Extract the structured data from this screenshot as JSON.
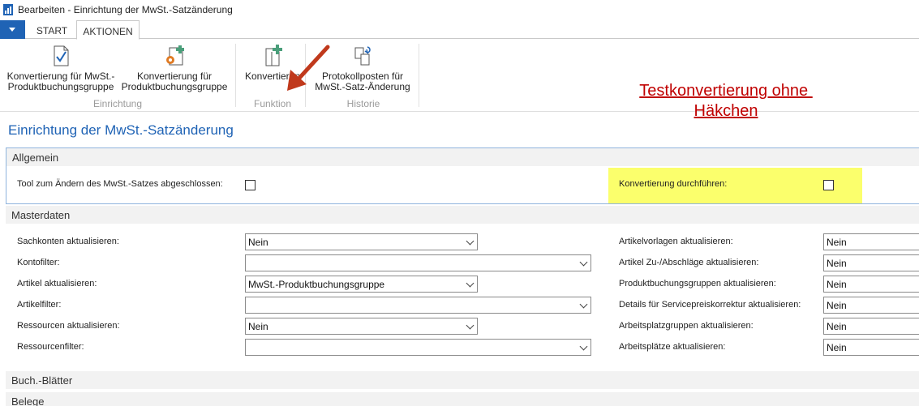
{
  "window": {
    "title": "Bearbeiten - Einrichtung der MwSt.-Satzänderung"
  },
  "tabs": {
    "start": "START",
    "aktionen": "AKTIONEN"
  },
  "ribbon": {
    "konv_mwst_line1": "Konvertierung für MwSt.-",
    "konv_mwst_line2": "Produktbuchungsgruppe",
    "konv_prod_line1": "Konvertierung für",
    "konv_prod_line2": "Produktbuchungsgruppe",
    "group_einrichtung": "Einrichtung",
    "konvertieren": "Konvertieren",
    "group_funktion": "Funktion",
    "protokoll_line1": "Protokollposten für",
    "protokoll_line2": "MwSt.-Satz-Änderung",
    "group_historie": "Historie"
  },
  "annotation": {
    "line1": "Testkonvertierung ohne ",
    "line2": "Häkchen"
  },
  "page_title": "Einrichtung der MwSt.-Satzänderung",
  "allgemein": {
    "header": "Allgemein",
    "tool_label": "Tool zum Ändern des MwSt.-Satzes abgeschlossen:",
    "konv_label": "Konvertierung durchführen:"
  },
  "masterdaten": {
    "header": "Masterdaten",
    "left": [
      {
        "label": "Sachkonten aktualisieren:",
        "value": "Nein"
      },
      {
        "label": "Kontofilter:",
        "value": ""
      },
      {
        "label": "Artikel aktualisieren:",
        "value": "MwSt.-Produktbuchungsgruppe"
      },
      {
        "label": "Artikelfilter:",
        "value": ""
      },
      {
        "label": "Ressourcen aktualisieren:",
        "value": "Nein"
      },
      {
        "label": "Ressourcenfilter:",
        "value": ""
      }
    ],
    "right": [
      {
        "label": "Artikelvorlagen aktualisieren:",
        "value": "Nein"
      },
      {
        "label": "Artikel Zu-/Abschläge aktualisieren:",
        "value": "Nein"
      },
      {
        "label": "Produktbuchungsgruppen aktualisieren:",
        "value": "Nein"
      },
      {
        "label": "Details für Servicepreiskorrektur aktualisieren:",
        "value": "Nein"
      },
      {
        "label": "Arbeitsplatzgruppen aktualisieren:",
        "value": "Nein"
      },
      {
        "label": "Arbeitsplätze aktualisieren:",
        "value": "Nein"
      }
    ]
  },
  "sections": {
    "buch_blaetter": "Buch.-Blätter",
    "belege": "Belege"
  },
  "colors": {
    "accent": "#1f63b5",
    "annotation": "#c00000",
    "highlight": "#fbff6c"
  }
}
